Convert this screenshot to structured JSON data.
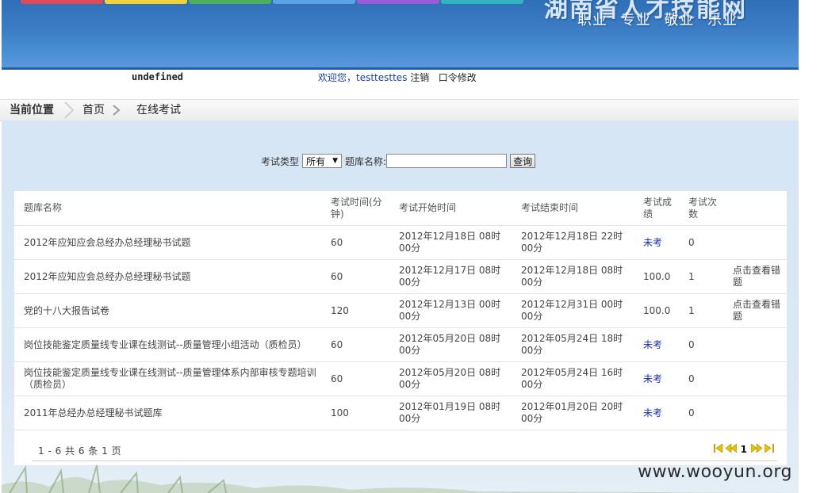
{
  "header": {
    "logo_text": "湖南省人才技能网",
    "slogan": "职业 专业 敬业 乐业",
    "nav_colors": [
      "#e04a5a",
      "#f2d23a",
      "#4caf5a",
      "#5aa3e6",
      "#9a5ad6",
      "#2fb5c0"
    ]
  },
  "infobar": {
    "undefined_text": "undefined",
    "welcome_prefix": "欢迎您，",
    "username": "testtesttes",
    "logout": "注销",
    "change_password": "口令修改"
  },
  "breadcrumb": {
    "label": "当前位置",
    "items": [
      "首页",
      "在线考试"
    ]
  },
  "search": {
    "type_label": "考试类型",
    "type_value": "所有",
    "name_label": "题库名称:",
    "name_value": "",
    "button": "查询"
  },
  "table": {
    "columns": [
      "题库名称",
      "考试时间(分钟)",
      "考试开始时间",
      "考试结束时间",
      "考试成绩",
      "考试次数",
      ""
    ],
    "rows": [
      {
        "name": "2012年应知应会总经办总经理秘书试题",
        "duration": "60",
        "start": "2012年12月18日 08时00分",
        "end": "2012年12月18日 22时00分",
        "score": "未考",
        "attempts": "0",
        "action": ""
      },
      {
        "name": "2012年应知应会总经办总经理秘书试题",
        "duration": "60",
        "start": "2012年12月17日 08时00分",
        "end": "2012年12月18日 08时00分",
        "score": "100.0",
        "attempts": "1",
        "action": "点击查看错题"
      },
      {
        "name": "党的十八大报告试卷",
        "duration": "120",
        "start": "2012年12月13日 00时00分",
        "end": "2012年12月31日 00时00分",
        "score": "100.0",
        "attempts": "1",
        "action": "点击查看错题"
      },
      {
        "name": "岗位技能鉴定质量线专业课在线测试--质量管理小组活动（质检员）",
        "duration": "60",
        "start": "2012年05月20日 08时00分",
        "end": "2012年05月24日 18时00分",
        "score": "未考",
        "attempts": "0",
        "action": ""
      },
      {
        "name": "岗位技能鉴定质量线专业课在线测试--质量管理体系内部审核专题培训（质检员）",
        "duration": "60",
        "start": "2012年05月20日 08时00分",
        "end": "2012年05月24日 16时00分",
        "score": "未考",
        "attempts": "0",
        "action": ""
      },
      {
        "name": "2011年总经办总经理秘书试题库",
        "duration": "100",
        "start": "2012年01月19日 08时00分",
        "end": "2012年01月20日 20时00分",
        "score": "未考",
        "attempts": "0",
        "action": ""
      }
    ]
  },
  "pager": {
    "summary": "1 - 6 共 6 条 1 页",
    "current_page": "1",
    "icons": [
      "first-page-icon",
      "prev-page-icon",
      "next-page-icon",
      "last-page-icon"
    ]
  },
  "watermark": "www.wooyun.org"
}
